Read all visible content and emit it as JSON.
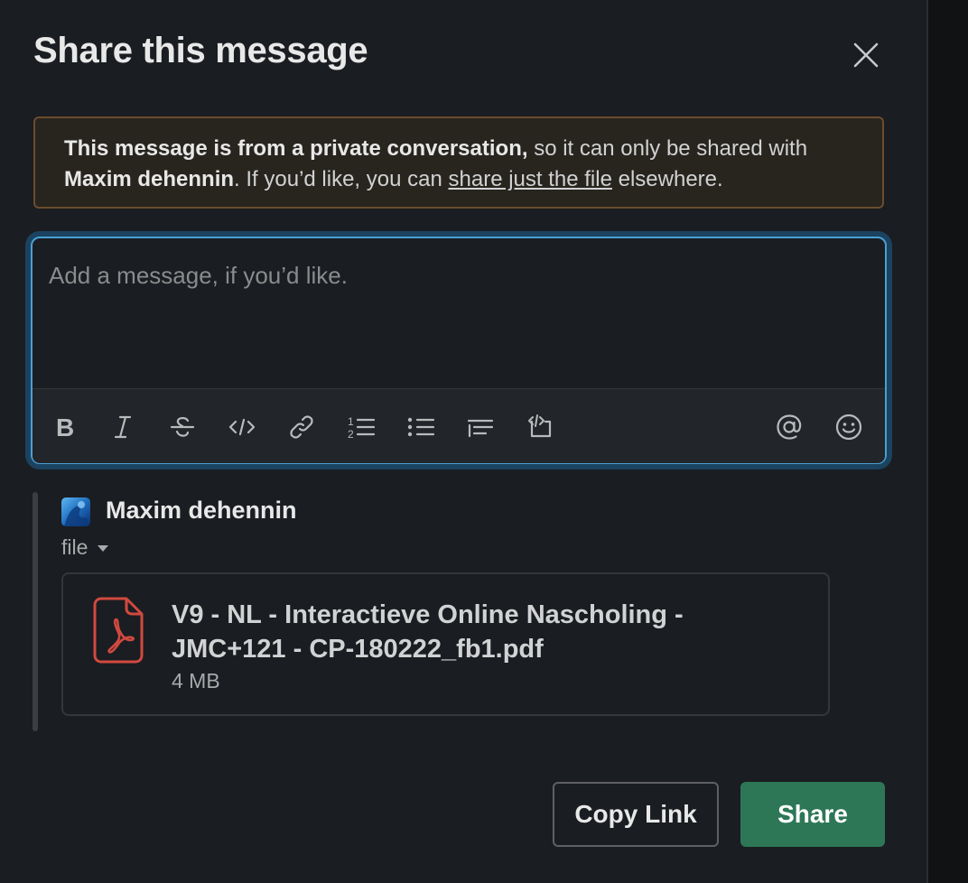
{
  "modal": {
    "title": "Share this message"
  },
  "notice": {
    "bold_intro": "This message is from a private conversation,",
    "text_1": " so it can only be shared with ",
    "recipient": "Maxim dehennin",
    "text_2": ". If you’d like, you can ",
    "link": "share just the file",
    "text_3": " elsewhere."
  },
  "composer": {
    "placeholder": "Add a message, if you’d like.",
    "value": "",
    "toolbar_icons": [
      "bold-icon",
      "italic-icon",
      "strikethrough-icon",
      "code-icon",
      "link-icon",
      "ordered-list-icon",
      "bulleted-list-icon",
      "blockquote-icon",
      "code-block-icon",
      "mention-icon",
      "emoji-icon"
    ]
  },
  "shared_message": {
    "sender": "Maxim dehennin",
    "label": "file",
    "file": {
      "name": "V9 - NL - Interactieve Online Nascholing - JMC+121 - CP-180222_fb1.pdf",
      "size": "4 MB",
      "icon": "pdf-icon"
    }
  },
  "buttons": {
    "copy_link": "Copy Link",
    "share": "Share"
  },
  "colors": {
    "accent_focus": "#4a9fd4",
    "share_button": "#2d7756",
    "notice_border": "#6b4d2e",
    "pdf_red": "#d1493f"
  }
}
